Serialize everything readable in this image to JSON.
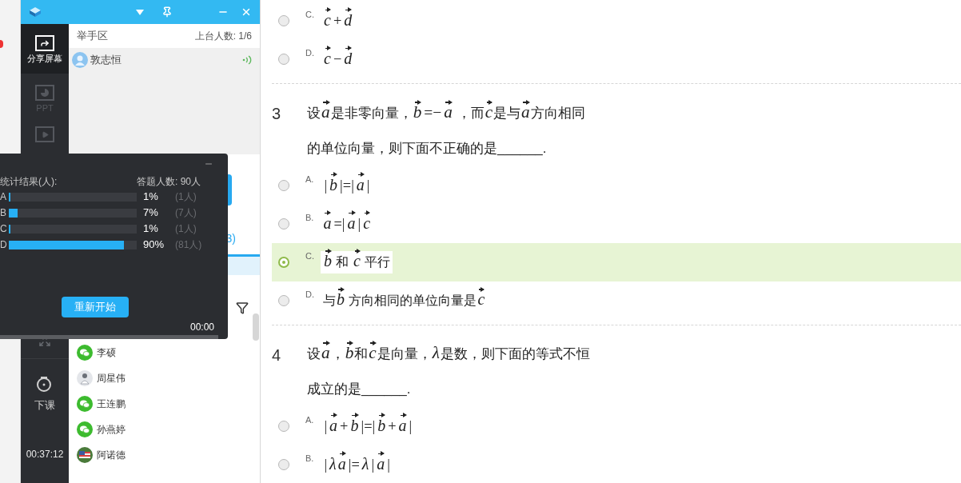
{
  "window": {
    "sidebar": {
      "items": [
        {
          "label": "分享屏幕",
          "selected": true,
          "disabled": false
        },
        {
          "label": "PPT",
          "selected": false,
          "disabled": true
        }
      ],
      "end_class": "下课",
      "timer": "00:37:12"
    },
    "hand_raise": {
      "title": "举手区",
      "count": "上台人数: 1/6",
      "users": [
        {
          "name": "敦志恒"
        }
      ]
    },
    "partial_tab": "3)",
    "participants": [
      {
        "name": "李硕",
        "kind": "wechat"
      },
      {
        "name": "周星伟",
        "kind": "photo"
      },
      {
        "name": "王连鹏",
        "kind": "wechat"
      },
      {
        "name": "孙燕婷",
        "kind": "wechat"
      },
      {
        "name": "阿诺德",
        "kind": "flag"
      }
    ]
  },
  "stats_popup": {
    "title": "统计结果(人):",
    "total": "答题人数: 90人",
    "rows": [
      {
        "label": "A",
        "level": 0.01,
        "percent": "1%",
        "count": "(1人)"
      },
      {
        "label": "B",
        "level": 0.07,
        "percent": "7%",
        "count": "(7人)"
      },
      {
        "label": "C",
        "level": 0.01,
        "percent": "1%",
        "count": "(1人)"
      },
      {
        "label": "D",
        "level": 0.9,
        "percent": "90%",
        "count": "(81人)"
      }
    ],
    "restart_button": "重新开始",
    "timer": "00:00"
  },
  "questions": [
    {
      "options": [
        {
          "letter": "C.",
          "selected": false,
          "parts": [
            {
              "kind": "vec",
              "text": "c"
            },
            {
              "kind": "sym",
              "text": "+"
            },
            {
              "kind": "vec",
              "text": "d"
            }
          ]
        },
        {
          "letter": "D.",
          "selected": false,
          "parts": [
            {
              "kind": "vec",
              "text": "c"
            },
            {
              "kind": "sym",
              "text": "−"
            },
            {
              "kind": "vec",
              "text": "d"
            }
          ]
        }
      ]
    },
    {
      "number": "3",
      "parts": [
        {
          "kind": "text",
          "text": "设"
        },
        {
          "kind": "vec",
          "text": "a"
        },
        {
          "kind": "text",
          "text": "是非零向量，"
        },
        {
          "kind": "vec",
          "text": "b"
        },
        {
          "kind": "sym",
          "text": "=−"
        },
        {
          "kind": "vec",
          "text": "a"
        },
        {
          "kind": "text",
          "text": " ，而"
        },
        {
          "kind": "vec",
          "text": "c"
        },
        {
          "kind": "text",
          "text": "是与"
        },
        {
          "kind": "vec",
          "text": "a"
        },
        {
          "kind": "text",
          "text": "方向相同"
        },
        {
          "kind": "break"
        },
        {
          "kind": "text",
          "text": "的单位向量，则下面不正确的是______."
        }
      ],
      "options": [
        {
          "letter": "A.",
          "selected": false,
          "parts": [
            {
              "kind": "sym",
              "text": "|"
            },
            {
              "kind": "vec",
              "text": "b"
            },
            {
              "kind": "sym",
              "text": "|=|"
            },
            {
              "kind": "vec",
              "text": "a"
            },
            {
              "kind": "sym",
              "text": "|"
            }
          ]
        },
        {
          "letter": "B.",
          "selected": false,
          "parts": [
            {
              "kind": "vec",
              "text": "a"
            },
            {
              "kind": "sym",
              "text": "=|"
            },
            {
              "kind": "vec",
              "text": "a"
            },
            {
              "kind": "sym",
              "text": "|"
            },
            {
              "kind": "vec",
              "text": "c"
            }
          ]
        },
        {
          "letter": "C.",
          "selected": true,
          "parts": [
            {
              "kind": "vec",
              "text": "b"
            },
            {
              "kind": "text",
              "text": " 和 "
            },
            {
              "kind": "vec",
              "text": "c"
            },
            {
              "kind": "text",
              "text": " 平行"
            }
          ]
        },
        {
          "letter": "D.",
          "selected": false,
          "parts": [
            {
              "kind": "text",
              "text": "与"
            },
            {
              "kind": "vec",
              "text": "b"
            },
            {
              "kind": "text",
              "text": " 方向相同的单位向量是"
            },
            {
              "kind": "vec",
              "text": "c"
            }
          ]
        }
      ]
    },
    {
      "number": "4",
      "parts": [
        {
          "kind": "text",
          "text": "设"
        },
        {
          "kind": "vec",
          "text": "a"
        },
        {
          "kind": "text",
          "text": "，"
        },
        {
          "kind": "vec",
          "text": "b"
        },
        {
          "kind": "text",
          "text": "和"
        },
        {
          "kind": "vec",
          "text": "c"
        },
        {
          "kind": "text",
          "text": "是向量，"
        },
        {
          "kind": "var",
          "text": "λ"
        },
        {
          "kind": "text",
          "text": "是数，则下面的等式不恒"
        },
        {
          "kind": "break"
        },
        {
          "kind": "text",
          "text": "成立的是______."
        }
      ],
      "options": [
        {
          "letter": "A.",
          "selected": false,
          "parts": [
            {
              "kind": "sym",
              "text": "|"
            },
            {
              "kind": "vec",
              "text": "a"
            },
            {
              "kind": "sym",
              "text": "+"
            },
            {
              "kind": "vec",
              "text": "b"
            },
            {
              "kind": "sym",
              "text": "|=|"
            },
            {
              "kind": "vec",
              "text": "b"
            },
            {
              "kind": "sym",
              "text": "+"
            },
            {
              "kind": "vec",
              "text": "a"
            },
            {
              "kind": "sym",
              "text": "|"
            }
          ]
        },
        {
          "letter": "B.",
          "selected": false,
          "parts": [
            {
              "kind": "sym",
              "text": "|"
            },
            {
              "kind": "var",
              "text": "λ"
            },
            {
              "kind": "vec",
              "text": "a"
            },
            {
              "kind": "sym",
              "text": "|="
            },
            {
              "kind": "var",
              "text": "λ"
            },
            {
              "kind": "sym",
              "text": "|"
            },
            {
              "kind": "vec",
              "text": "a"
            },
            {
              "kind": "sym",
              "text": "|"
            }
          ]
        }
      ]
    }
  ]
}
